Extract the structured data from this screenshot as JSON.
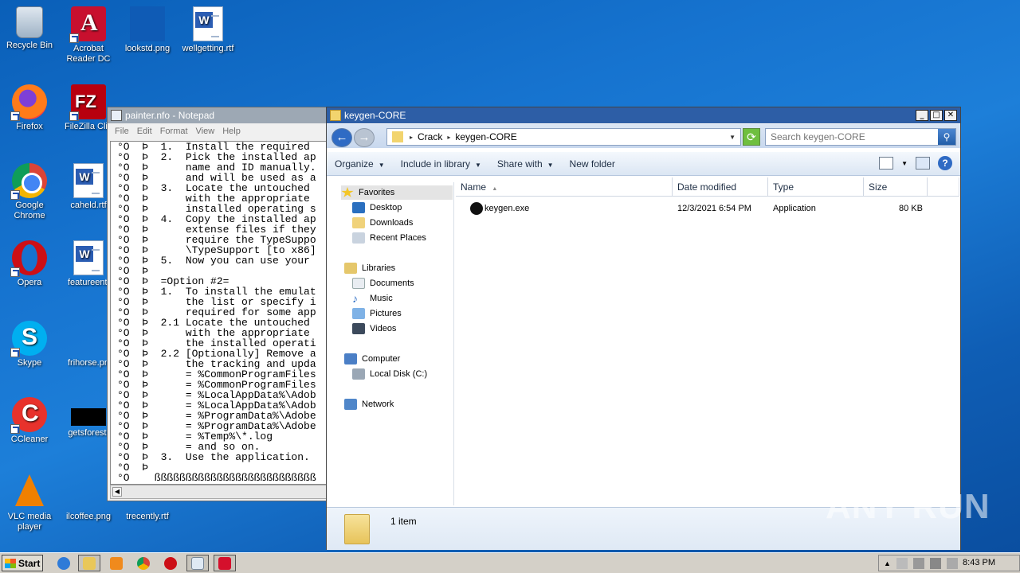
{
  "desktop": {
    "icons": [
      {
        "label": "Recycle Bin",
        "icon": "recycle-bin-icon"
      },
      {
        "label": "Acrobat Reader DC",
        "icon": "acrobat-icon"
      },
      {
        "label": "lookstd.png",
        "icon": "image-file-icon"
      },
      {
        "label": "wellgetting.rtf",
        "icon": "word-doc-icon"
      },
      {
        "label": "Firefox",
        "icon": "firefox-icon"
      },
      {
        "label": "FileZilla Clie",
        "icon": "filezilla-icon"
      },
      {
        "label": "Google Chrome",
        "icon": "chrome-icon"
      },
      {
        "label": "caheld.rtf",
        "icon": "word-doc-icon"
      },
      {
        "label": "Opera",
        "icon": "opera-icon"
      },
      {
        "label": "featureenti",
        "icon": "word-doc-icon"
      },
      {
        "label": "Skype",
        "icon": "skype-icon"
      },
      {
        "label": "frihorse.pn",
        "icon": "image-file-icon"
      },
      {
        "label": "CCleaner",
        "icon": "ccleaner-icon"
      },
      {
        "label": "getsforest.",
        "icon": "image-file-icon"
      },
      {
        "label": "VLC media player",
        "icon": "vlc-icon"
      },
      {
        "label": "ilcoffee.png",
        "icon": "image-file-icon"
      },
      {
        "label": "trecently.rtf",
        "icon": "word-doc-icon"
      }
    ]
  },
  "notepad": {
    "title": "painter.nfo - Notepad",
    "menu": [
      "File",
      "Edit",
      "Format",
      "View",
      "Help"
    ],
    "lines": [
      "°O  Þ  1.  Install the required",
      "°O  Þ  2.  Pick the installed ap",
      "°O  Þ      name and ID manually.",
      "°O  Þ      and will be used as a",
      "°O  Þ  3.  Locate the untouched",
      "°O  Þ      with the appropriate",
      "°O  Þ      installed operating s",
      "°O  Þ  4.  Copy the installed ap",
      "°O  Þ      extense files if they",
      "°O  Þ      require the TypeSuppo",
      "°O  Þ      \\TypeSupport [to x86]",
      "°O  Þ  5.  Now you can use your",
      "°O  Þ",
      "°O  Þ  =Option #2=",
      "°O  Þ  1.  To install the emulat",
      "°O  Þ      the list or specify i",
      "°O  Þ      required for some app",
      "°O  Þ  2.1 Locate the untouched",
      "°O  Þ      with the appropriate",
      "°O  Þ      the installed operati",
      "°O  Þ  2.2 [Optionally] Remove a",
      "°O  Þ      the tracking and upda",
      "°O  Þ      = %CommonProgramFiles",
      "°O  Þ      = %CommonProgramFiles",
      "°O  Þ      = %LocalAppData%\\Adob",
      "°O  Þ      = %LocalAppData%\\Adob",
      "°O  Þ      = %ProgramData%\\Adobe",
      "°O  Þ      = %ProgramData%\\Adobe",
      "°O  Þ      = %Temp%\\*.log",
      "°O  Þ      = and so on.",
      "°O  Þ  3.  Use the application.",
      "°O  Þ",
      "°O    ßßßßßßßßßßßßßßßßßßßßßßßßßß"
    ]
  },
  "explorer": {
    "title": "keygen-CORE",
    "breadcrumb": [
      "Crack",
      "keygen-CORE"
    ],
    "search_placeholder": "Search keygen-CORE",
    "toolbar": {
      "organize": "Organize",
      "include_in_library": "Include in library",
      "share_with": "Share with",
      "new_folder": "New folder"
    },
    "nav": {
      "favorites": "Favorites",
      "desktop": "Desktop",
      "downloads": "Downloads",
      "recent_places": "Recent Places",
      "libraries": "Libraries",
      "documents": "Documents",
      "music": "Music",
      "pictures": "Pictures",
      "videos": "Videos",
      "computer": "Computer",
      "local_disk": "Local Disk (C:)",
      "network": "Network"
    },
    "columns": {
      "name": "Name",
      "date": "Date modified",
      "type": "Type",
      "size": "Size"
    },
    "files": [
      {
        "name": "keygen.exe",
        "date": "12/3/2021 6:54 PM",
        "type": "Application",
        "size": "80 KB"
      }
    ],
    "status": "1 item"
  },
  "watermark": "ANY RUN",
  "taskbar": {
    "start_label": "Start",
    "clock": "8:43 PM"
  }
}
